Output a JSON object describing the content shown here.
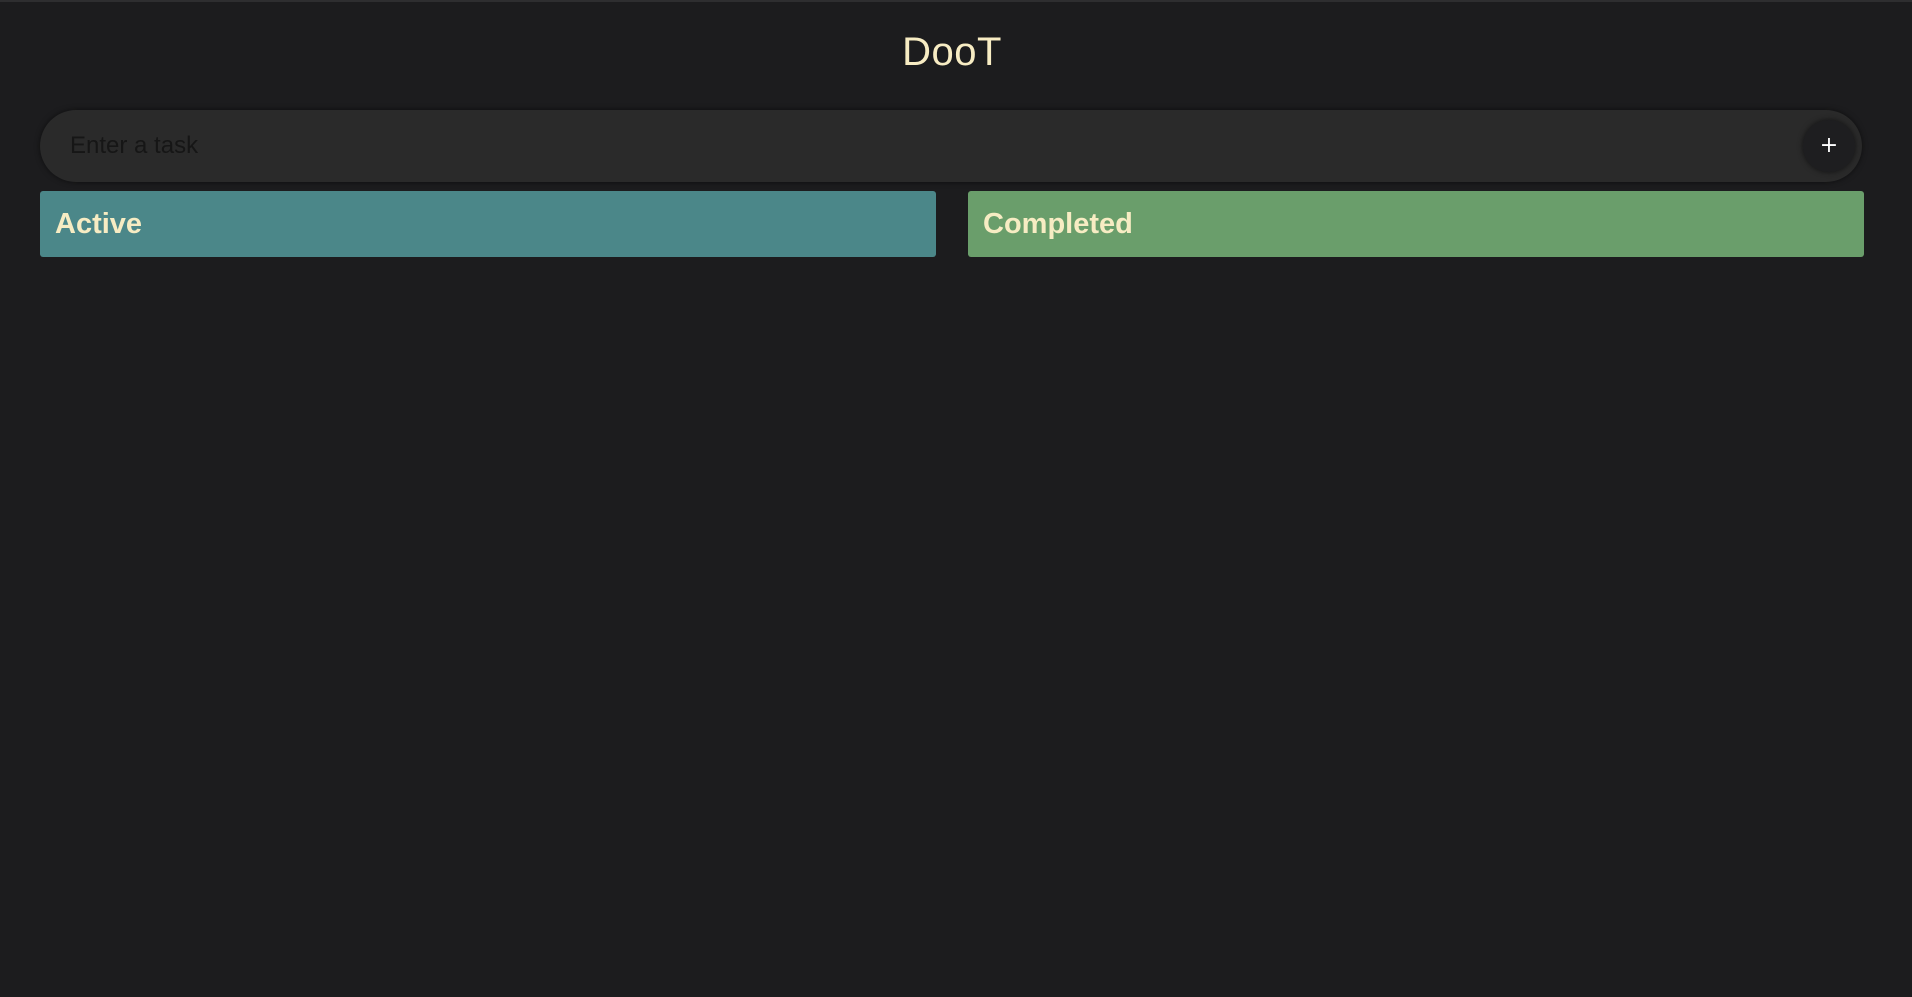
{
  "app": {
    "title": "DooT"
  },
  "task_entry": {
    "placeholder": "Enter a task",
    "value": "",
    "add_button_label": "+"
  },
  "columns": [
    {
      "label": "Active",
      "color": "#4b8789",
      "tasks": []
    },
    {
      "label": "Completed",
      "color": "#6a9e6b",
      "tasks": []
    }
  ],
  "colors": {
    "background": "#1c1c1e",
    "title_text": "#f7ecc3",
    "input_background": "#2a2a2a"
  }
}
